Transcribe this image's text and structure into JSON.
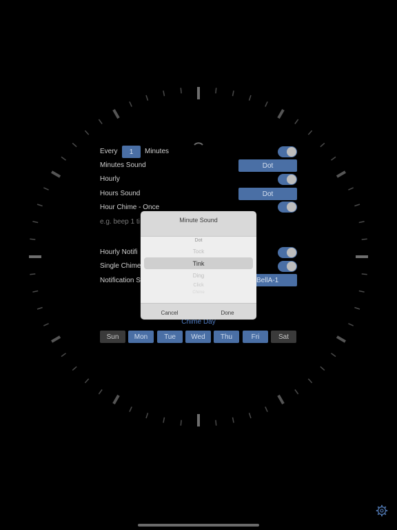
{
  "settings": {
    "every_label": "Every",
    "every_value": "1",
    "minutes_label": "Minutes",
    "minutes_sound_label": "Minutes Sound",
    "minutes_sound_value": "Dot",
    "hourly_label": "Hourly",
    "hours_sound_label": "Hours Sound",
    "hours_sound_value": "Dot",
    "hour_chime_label": "Hour Chime - Once",
    "hint_text": "e.g. beep 1 ti",
    "hourly_notif_label": "Hourly Notifi",
    "single_chime_label": "Single Chime",
    "notification_label": "Notification S",
    "notification_value": "BellA-1",
    "toggles": {
      "minutes": true,
      "hourly": true,
      "hour_chime_once": true,
      "hourly_notification": true,
      "single_chime": true
    }
  },
  "chime_day": {
    "title": "Chime Day",
    "days": [
      {
        "label": "Sun",
        "on": false
      },
      {
        "label": "Mon",
        "on": true
      },
      {
        "label": "Tue",
        "on": true
      },
      {
        "label": "Wed",
        "on": true
      },
      {
        "label": "Thu",
        "on": true
      },
      {
        "label": "Fri",
        "on": true
      },
      {
        "label": "Sat",
        "on": false
      }
    ]
  },
  "picker": {
    "title": "Minute Sound",
    "items": [
      "Dot",
      "Tock",
      "Tink",
      "Ding",
      "Click",
      "Chime"
    ],
    "selected": "Tink",
    "cancel_label": "Cancel",
    "done_label": "Done"
  },
  "colors": {
    "accent": "#4a6fa5",
    "background": "#000000",
    "tick": "#8a8a8a"
  },
  "icons": [
    "gear-icon"
  ]
}
